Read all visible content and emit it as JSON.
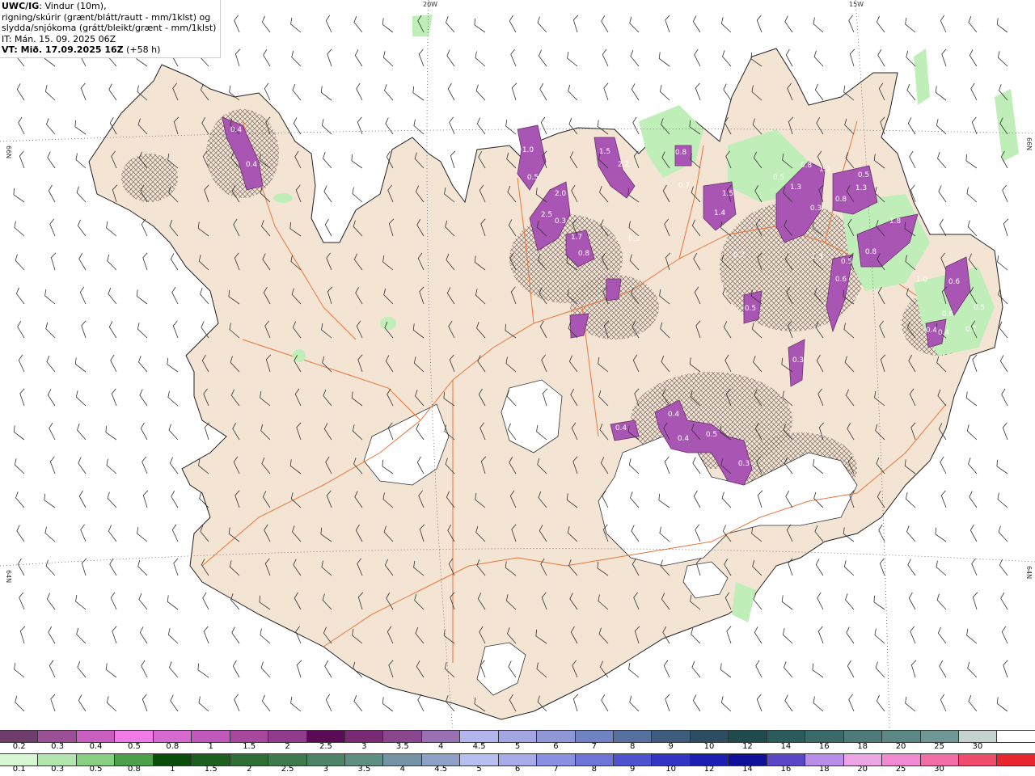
{
  "header": {
    "model": "UWC/IG",
    "line1": ": Vindur (10m),",
    "line2": "rigning/skúrir (grænt/blátt/rautt - mm/1klst) og",
    "line3": "slydda/snjókoma (grátt/bleikt/grænt - mm/1klst)",
    "it": "IT: Mán. 15. 09. 2025 06Z",
    "vt_label": "VT: Mið. 17.09.2025 16Z",
    "vt_offset": " (+58 h)"
  },
  "graticule": {
    "lon_20w": "20W",
    "lon_15w": "15W",
    "lat_66n_left": "66N",
    "lat_66n_right": "66N",
    "lat_64n_left": "64N",
    "lat_64n_right": "64N"
  },
  "precip_labels": [
    "0.4",
    "0.4",
    "1.0",
    "0.5",
    "1.5",
    "2.2",
    "0.8",
    "2.0",
    "2.5",
    "0.3",
    "1.7",
    "0.8",
    "0.3",
    "0.7",
    "1.4",
    "1.5",
    "1.3",
    "0.5",
    "0.8",
    "1.2",
    "0.8",
    "0.3",
    "1.3",
    "0.5",
    "0.5",
    "1.3",
    "0.8",
    "1.8",
    "1.0",
    "0.6",
    "0.5",
    "0.3",
    "0.7",
    "0.6",
    "0.4",
    "0.6",
    "0.5",
    "0.4",
    "0.7",
    "0.4",
    "0.4",
    "0.4",
    "0.5",
    "0.3"
  ],
  "legend_top": {
    "colors": [
      "#6f3d6b",
      "#9b4f97",
      "#c85fc0",
      "#f07ae6",
      "#d66ad0",
      "#c059bb",
      "#a9479f",
      "#923a8b",
      "#5b0a55",
      "#7a2a75",
      "#8a4790",
      "#9a70b4",
      "#b5b5ee",
      "#a3a6e2",
      "#8f97d6",
      "#6f83c2",
      "#56709f",
      "#3e5c7e",
      "#2d4e62",
      "#1f4b4e",
      "#2a5b5d",
      "#3b6a6a",
      "#4e7b7a",
      "#5b8885",
      "#6f9795",
      "#c5d2d0",
      "#ffffff"
    ],
    "ticks": [
      "0.2",
      "0.3",
      "0.4",
      "0.5",
      "0.8",
      "1",
      "1.5",
      "2",
      "2.5",
      "3",
      "3.5",
      "4",
      "4.5",
      "5",
      "6",
      "7",
      "8",
      "9",
      "10",
      "12",
      "14",
      "16",
      "18",
      "20",
      "25",
      "30"
    ]
  },
  "legend_bottom": {
    "colors": [
      "#d7f7d3",
      "#b3e6ae",
      "#88cf84",
      "#4da04a",
      "#0b4d0b",
      "#1d5f1f",
      "#2f6f35",
      "#3e7a4c",
      "#4e8466",
      "#5f8f83",
      "#7494a6",
      "#8fa0c7",
      "#b7bff0",
      "#a7abea",
      "#8b91e2",
      "#6f74d9",
      "#4f52cf",
      "#3135c2",
      "#1d1fb2",
      "#100f9a",
      "#5b47c6",
      "#b98ee8",
      "#eca6e6",
      "#f28ad1",
      "#f16da6",
      "#ef4b6a",
      "#e8262e"
    ],
    "ticks": [
      "0.1",
      "0.3",
      "0.5",
      "0.8",
      "1",
      "1.5",
      "2",
      "2.5",
      "3",
      "3.5",
      "4",
      "4.5",
      "5",
      "6",
      "7",
      "8",
      "9",
      "10",
      "12",
      "14",
      "16",
      "18",
      "20",
      "25",
      "30"
    ]
  }
}
